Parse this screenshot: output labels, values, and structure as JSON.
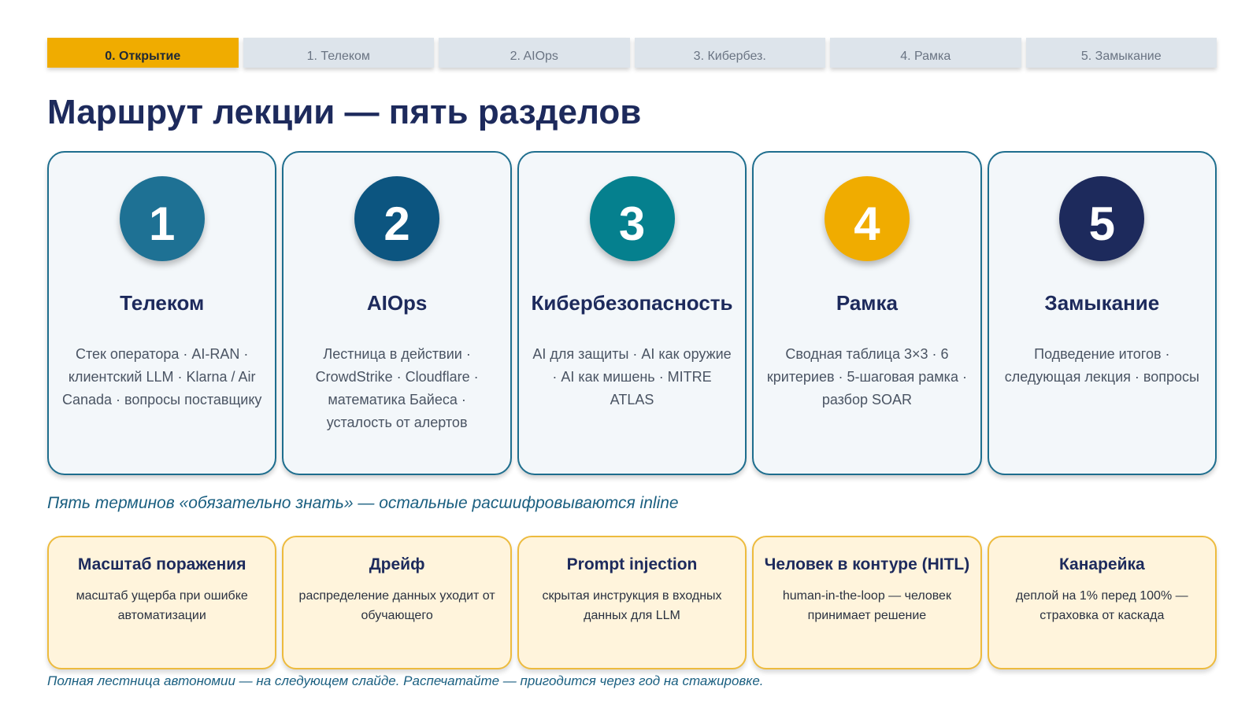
{
  "tabs": [
    {
      "label": "0. Открытие",
      "active": true
    },
    {
      "label": "1. Телеком",
      "active": false
    },
    {
      "label": "2. AIOps",
      "active": false
    },
    {
      "label": "3. Кибербез.",
      "active": false
    },
    {
      "label": "4. Рамка",
      "active": false
    },
    {
      "label": "5. Замыкание",
      "active": false
    }
  ],
  "title": "Маршрут лекции — пять разделов",
  "sections": [
    {
      "number": "1",
      "color": "#1e7194",
      "title": "Телеком",
      "desc": "Стек оператора · AI-RAN · клиентский LLM · Klarna / Air Canada · вопросы поставщику"
    },
    {
      "number": "2",
      "color": "#0c5580",
      "title": "AIOps",
      "desc": "Лестница в действии · CrowdStrike · Cloudflare · математика Байеса · усталость от алертов"
    },
    {
      "number": "3",
      "color": "#05808e",
      "title": "Кибербезопасность",
      "desc": "AI для защиты · AI как оружие · AI как мишень · MITRE ATLAS"
    },
    {
      "number": "4",
      "color": "#f0ac00",
      "title": "Рамка",
      "desc": "Сводная таблица 3×3 · 6 критериев · 5-шаговая рамка · разбор SOAR"
    },
    {
      "number": "5",
      "color": "#1d2a5c",
      "title": "Замыкание",
      "desc": "Подведение итогов · следующая лекция · вопросы"
    }
  ],
  "subtitle": "Пять терминов «обязательно знать» — остальные расшифровываются inline",
  "terms": [
    {
      "title": "Масштаб поражения",
      "desc": "масштаб ущерба при ошибке автоматизации"
    },
    {
      "title": "Дрейф",
      "desc": "распределение данных уходит от обучающего"
    },
    {
      "title": "Prompt injection",
      "desc": "скрытая инструкция в входных данных для LLM"
    },
    {
      "title": "Человек в контуре (HITL)",
      "desc": "human-in-the-loop — человек принимает решение"
    },
    {
      "title": "Канарейка",
      "desc": "деплой на 1% перед 100% — страховка от каскада"
    }
  ],
  "footer": "Полная лестница автономии — на следующем слайде. Распечатайте — пригодится через год на стажировке."
}
